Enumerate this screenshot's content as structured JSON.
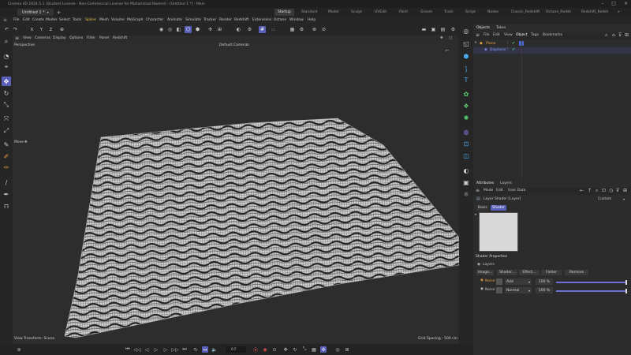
{
  "title_bar": {
    "title": "Cinema 4D 2024.5.1 (Student License - Non-Commercial License for Mohammad Naeimi) - [Untitled 1 *] - Main"
  },
  "doc_tabs": {
    "active": "Untitled 1 *",
    "add": "+"
  },
  "layouts": [
    "Startup",
    "Standard",
    "Model",
    "Sculpt",
    "UVEdit",
    "Paint",
    "Groom",
    "Track",
    "Script",
    "Nodes",
    "Classic_Redshift",
    "Octane_Redsh",
    "Redshift_Redsh"
  ],
  "main_menu": [
    "File",
    "Edit",
    "Create",
    "Modes",
    "Select",
    "Tools",
    "Spline",
    "Mesh",
    "Volume",
    "MoGraph",
    "Character",
    "Animate",
    "Simulate",
    "Tracker",
    "Render",
    "Redshift",
    "Extensions",
    "Octane",
    "Window",
    "Help"
  ],
  "axis_buttons": [
    "X",
    "Y",
    "Z"
  ],
  "viewport": {
    "menu": [
      "View",
      "Cameras",
      "Display",
      "Options",
      "Filter",
      "Panel",
      "Redshift"
    ],
    "projection": "Perspective",
    "camera": "Default Camera",
    "camera_glyph": "⊙",
    "tool_label": "Move",
    "tool_glyph": "✥",
    "status_left": "View Transform: Scene",
    "status_right": "Grid Spacing : 500 cm"
  },
  "timeline": {
    "frame": "0 F"
  },
  "objects_panel": {
    "tabs": [
      "Objects",
      "Takes"
    ],
    "menu": [
      "File",
      "Edit",
      "View",
      "Object",
      "Tags",
      "Bookmarks"
    ],
    "items": [
      {
        "name": "Plane",
        "color": "#e8a040"
      },
      {
        "name": "Displacer",
        "color": "#8aa0ff"
      }
    ]
  },
  "attributes_panel": {
    "tabs": [
      "Attributes",
      "Layers"
    ],
    "menu": [
      "Mode",
      "Edit",
      "User Data"
    ],
    "object_label": "Layer Shader [Layer]",
    "preset": "Custom",
    "sub_tabs": [
      "Basic",
      "Shader"
    ],
    "section": "Shader Properties",
    "layers_label": "Layers",
    "buttons": [
      "Image...",
      "Shader...",
      "Effect...",
      "Folder",
      "Remove"
    ],
    "layers": [
      {
        "name": "Noise",
        "mode": "Add",
        "value": "100 %",
        "color": "#e8a040",
        "amount": 1.0
      },
      {
        "name": "Noise",
        "mode": "Normal",
        "value": "100 %",
        "color": "#c8c8c8",
        "amount": 1.0
      }
    ]
  },
  "accent_color": "#5a5fb8"
}
